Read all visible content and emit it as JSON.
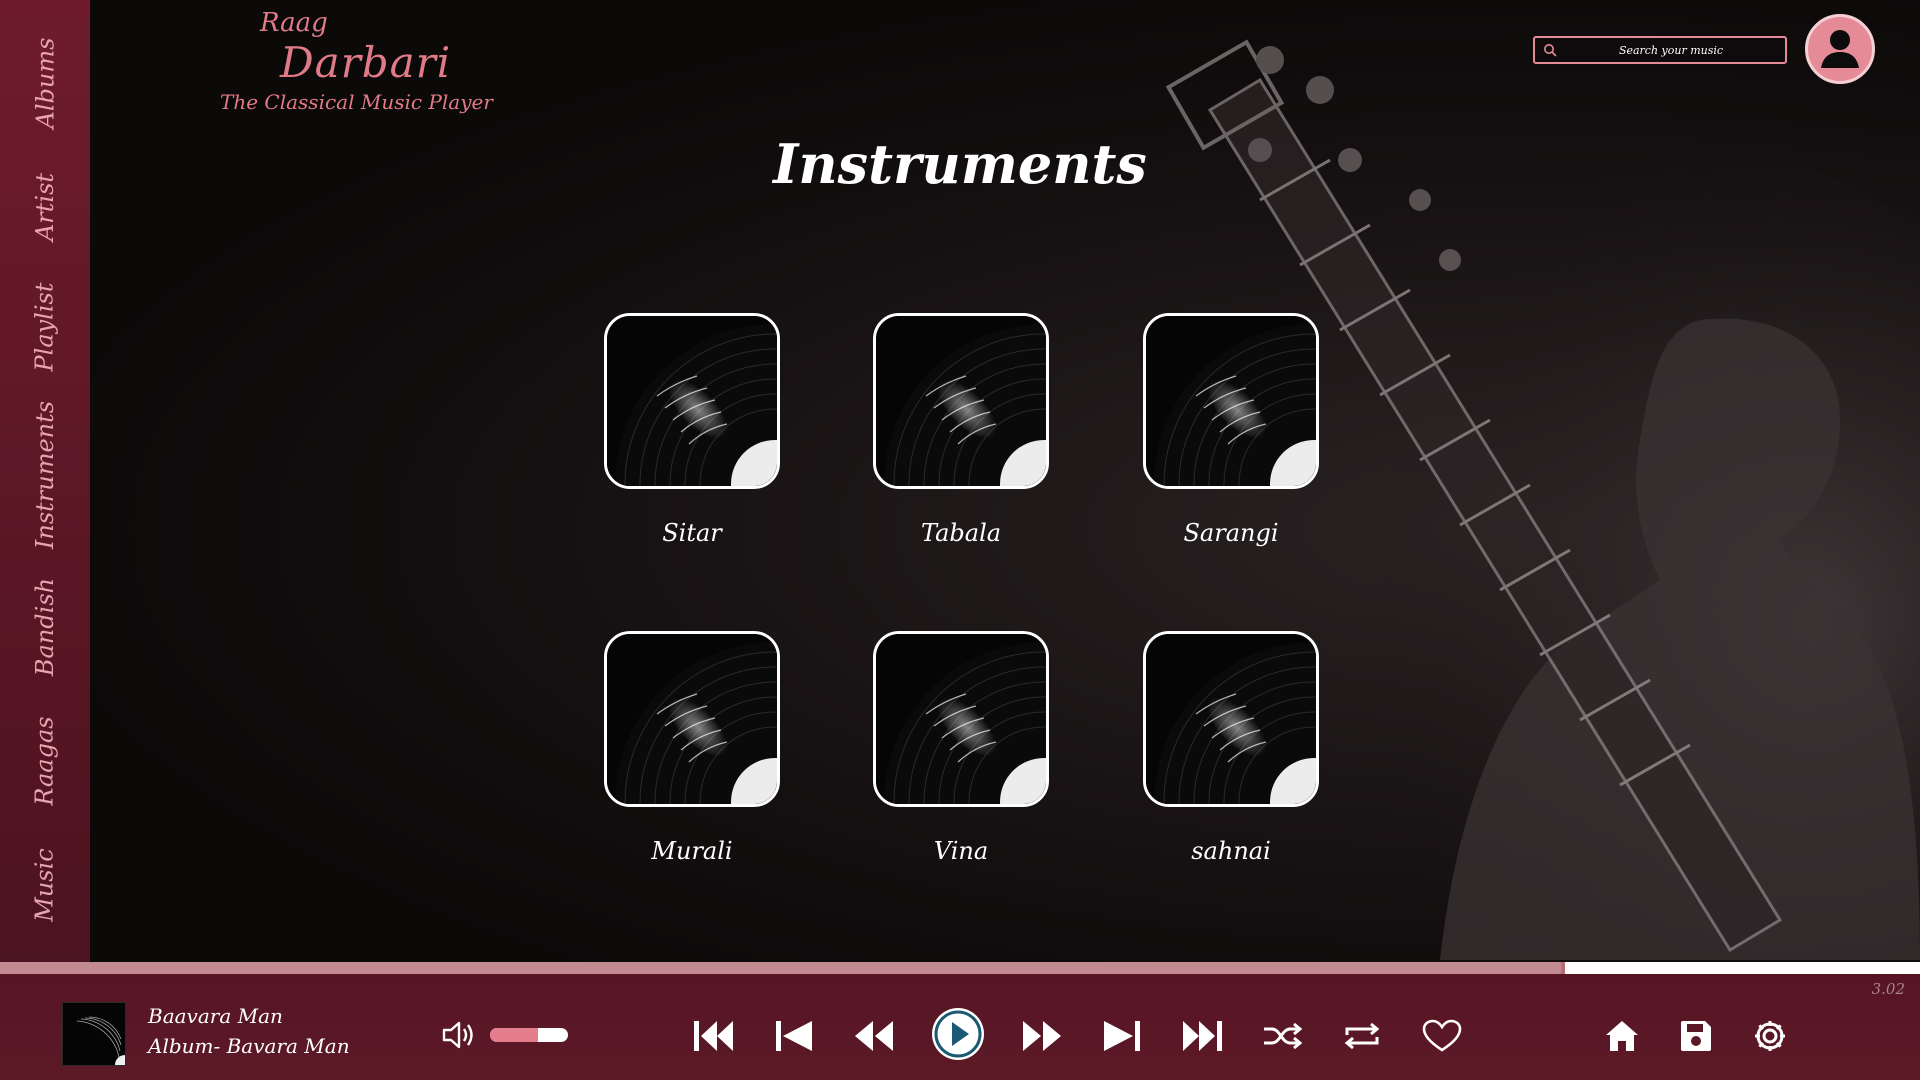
{
  "app": {
    "logo_line1": "Raag",
    "logo_line2": "Darbari",
    "logo_line3": "The Classical Music Player",
    "accent_color": "#e07a86",
    "sidebar_color": "#6e1c2c"
  },
  "sidebar": {
    "items": [
      {
        "label": "Albums"
      },
      {
        "label": "Artist"
      },
      {
        "label": "Playlist"
      },
      {
        "label": "Instruments"
      },
      {
        "label": "Bandish"
      },
      {
        "label": "Raagas"
      },
      {
        "label": "Music"
      }
    ]
  },
  "search": {
    "placeholder": "Search your music",
    "icon": "search-icon"
  },
  "profile": {
    "icon": "user-icon"
  },
  "page": {
    "title": "Instruments"
  },
  "instruments": [
    {
      "label": "Sitar",
      "icon": "vinyl-record-icon"
    },
    {
      "label": "Tabala",
      "icon": "vinyl-record-icon"
    },
    {
      "label": "Sarangi",
      "icon": "vinyl-record-icon"
    },
    {
      "label": "Murali",
      "icon": "vinyl-record-icon"
    },
    {
      "label": "Vina",
      "icon": "vinyl-record-icon"
    },
    {
      "label": "sahnai",
      "icon": "vinyl-record-icon"
    }
  ],
  "player": {
    "progress_fraction": 0.815,
    "elapsed": "3.02",
    "song_title": "Baavara Man",
    "album": "Album- Bavara Man",
    "volume_fraction": 0.62,
    "controls": {
      "skip_back": "skip-to-start-icon",
      "previous": "previous-track-icon",
      "rewind": "rewind-icon",
      "play": "play-icon",
      "fast_forward": "fast-forward-icon",
      "next": "next-track-icon",
      "skip_forward": "skip-to-end-icon",
      "shuffle": "shuffle-icon",
      "repeat": "repeat-icon",
      "favorite": "heart-icon",
      "home": "home-icon",
      "save": "save-icon",
      "settings": "settings-icon"
    }
  }
}
